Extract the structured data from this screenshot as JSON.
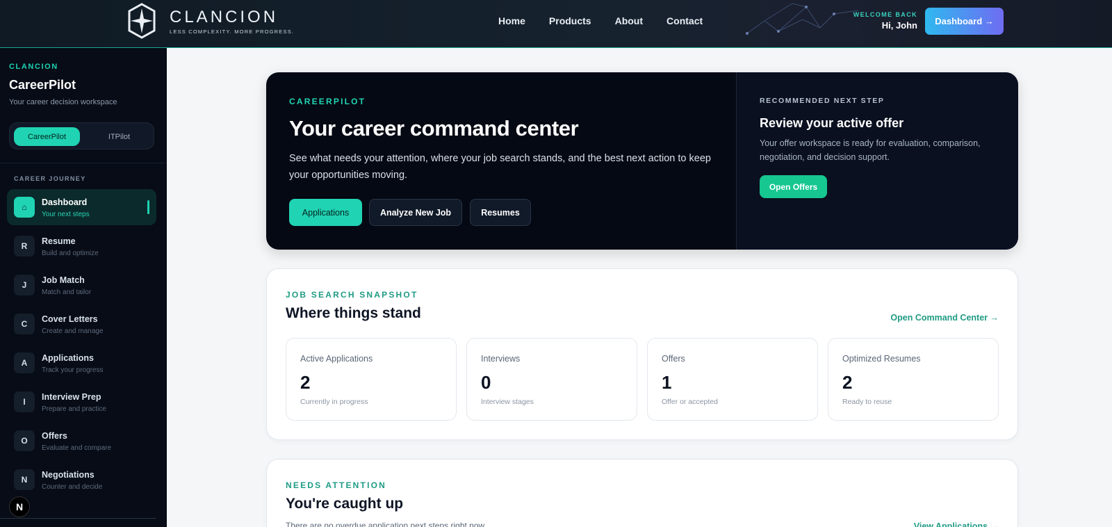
{
  "header": {
    "logo_name": "CLANCION",
    "logo_tagline": "LESS COMPLEXITY. MORE PROGRESS.",
    "nav": [
      "Home",
      "Products",
      "About",
      "Contact"
    ],
    "welcome_label": "WELCOME BACK",
    "welcome_name": "Hi, John",
    "dashboard_button": "Dashboard →"
  },
  "sidebar": {
    "brand": "CLANCION",
    "title": "CareerPilot",
    "subtitle": "Your career decision workspace",
    "toggle": {
      "active": "CareerPilot",
      "inactive": "ITPilot"
    },
    "section_label": "CAREER JOURNEY",
    "items": [
      {
        "badge": "⌂",
        "label": "Dashboard",
        "desc": "Your next steps",
        "active": true
      },
      {
        "badge": "R",
        "label": "Resume",
        "desc": "Build and optimize"
      },
      {
        "badge": "J",
        "label": "Job Match",
        "desc": "Match and tailor"
      },
      {
        "badge": "C",
        "label": "Cover Letters",
        "desc": "Create and manage"
      },
      {
        "badge": "A",
        "label": "Applications",
        "desc": "Track your progress"
      },
      {
        "badge": "I",
        "label": "Interview Prep",
        "desc": "Prepare and practice"
      },
      {
        "badge": "O",
        "label": "Offers",
        "desc": "Evaluate and compare"
      },
      {
        "badge": "N",
        "label": "Negotiations",
        "desc": "Counter and decide"
      }
    ],
    "bottom_badge": "N"
  },
  "hero": {
    "kicker": "CAREERPILOT",
    "title": "Your career command center",
    "description": "See what needs your attention, where your job search stands, and the best next action to keep your opportunities moving.",
    "buttons": [
      "Applications",
      "Analyze New Job",
      "Resumes"
    ],
    "right": {
      "kicker": "RECOMMENDED NEXT STEP",
      "title": "Review your active offer",
      "description": "Your offer workspace is ready for evaluation, comparison, negotiation, and decision support.",
      "button": "Open Offers"
    }
  },
  "snapshot": {
    "kicker": "JOB SEARCH SNAPSHOT",
    "title": "Where things stand",
    "link": "Open Command Center →",
    "stats": [
      {
        "label": "Active Applications",
        "value": "2",
        "sub": "Currently in progress"
      },
      {
        "label": "Interviews",
        "value": "0",
        "sub": "Interview stages"
      },
      {
        "label": "Offers",
        "value": "1",
        "sub": "Offer or accepted"
      },
      {
        "label": "Optimized Resumes",
        "value": "2",
        "sub": "Ready to reuse"
      }
    ]
  },
  "attention": {
    "kicker": "NEEDS ATTENTION",
    "title": "You're caught up",
    "text": "There are no overdue application next steps right now.",
    "link": "View Applications →"
  },
  "colors": {
    "accent": "#20d3b3",
    "dark": "#050913",
    "sidebar": "#070c17"
  }
}
